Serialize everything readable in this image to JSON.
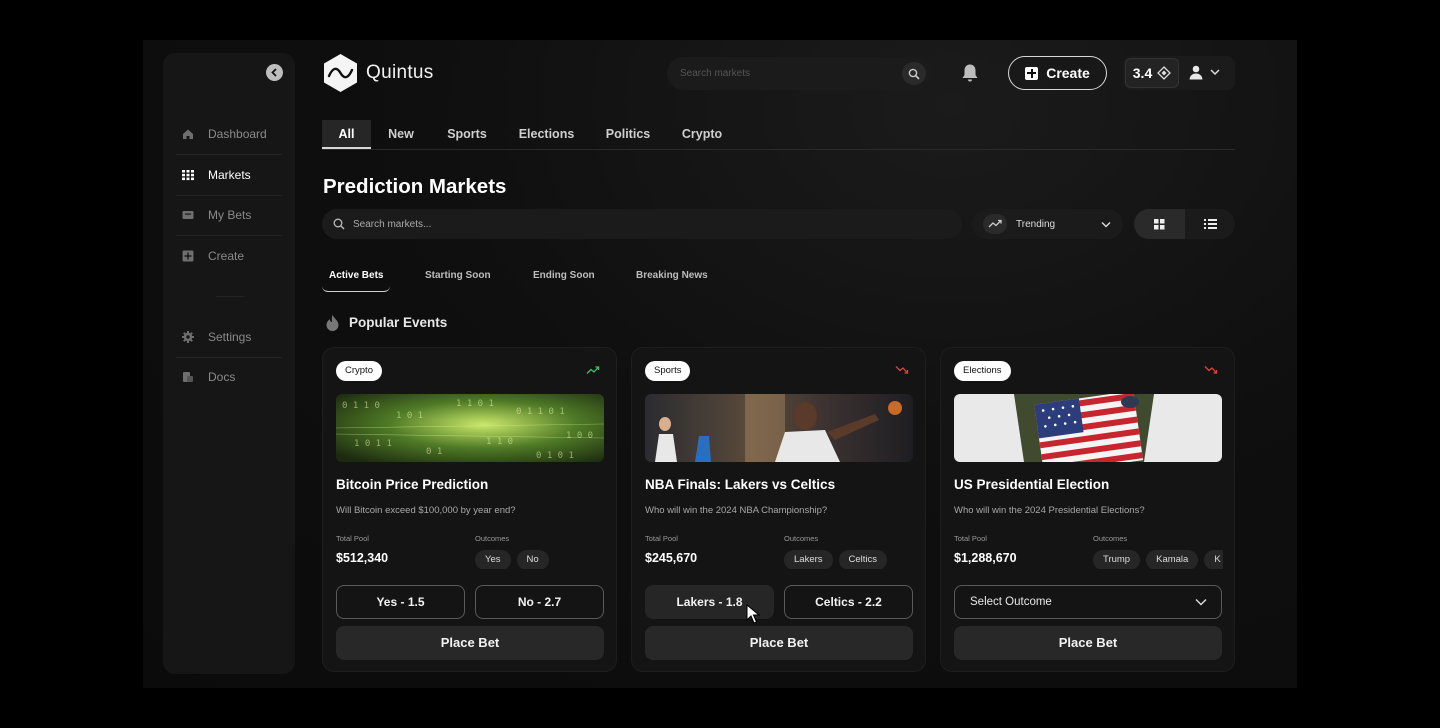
{
  "brand": {
    "name": "Quintus"
  },
  "sidebar": {
    "items": [
      {
        "label": "Dashboard",
        "icon": "home-icon"
      },
      {
        "label": "Markets",
        "icon": "grid-icon",
        "active": true
      },
      {
        "label": "My Bets",
        "icon": "ticket-icon"
      },
      {
        "label": "Create",
        "icon": "plus-square-icon"
      },
      {
        "label": "Settings",
        "icon": "gear-icon"
      },
      {
        "label": "Docs",
        "icon": "docs-icon"
      }
    ]
  },
  "header": {
    "search_placeholder": "Search markets",
    "create_label": "Create",
    "balance": "3.4"
  },
  "tabs": [
    "All",
    "New",
    "Sports",
    "Elections",
    "Politics",
    "Crypto"
  ],
  "active_tab": "All",
  "page_title": "Prediction Markets",
  "filters": {
    "search_placeholder": "Search markets...",
    "sort_label": "Trending"
  },
  "subtabs": [
    "Active Bets",
    "Starting Soon",
    "Ending Soon",
    "Breaking News"
  ],
  "section_title": "Popular Events",
  "labels": {
    "total_pool": "Total Pool",
    "outcomes": "Outcomes",
    "place_bet": "Place Bet",
    "select_outcome": "Select Outcome"
  },
  "cards": [
    {
      "category": "Crypto",
      "trend": "up",
      "title": "Bitcoin Price Prediction",
      "question": "Will Bitcoin exceed $100,000 by year end?",
      "pool": "$512,340",
      "outcomes": [
        "Yes",
        "No"
      ],
      "options": [
        "Yes - 1.5",
        "No - 2.7"
      ]
    },
    {
      "category": "Sports",
      "trend": "down",
      "title": "NBA Finals: Lakers vs Celtics",
      "question": "Who will win the 2024 NBA Championship?",
      "pool": "$245,670",
      "outcomes": [
        "Lakers",
        "Celtics"
      ],
      "options": [
        "Lakers - 1.8",
        "Celtics - 2.2"
      ]
    },
    {
      "category": "Elections",
      "trend": "down",
      "title": "US Presidential Election",
      "question": "Who will win the 2024 Presidential Elections?",
      "pool": "$1,288,670",
      "outcomes": [
        "Trump",
        "Kamala",
        "K"
      ]
    }
  ],
  "colors": {
    "trend_up": "#3fbf6a",
    "trend_down": "#e0453a",
    "background": "#0b0b0b",
    "card": "#141414"
  }
}
